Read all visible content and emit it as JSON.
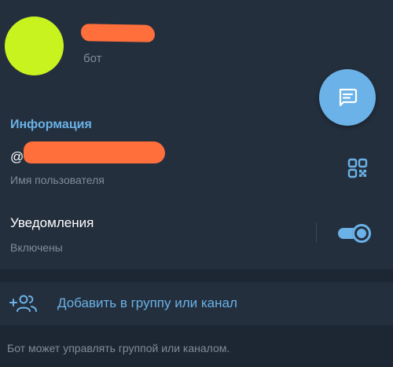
{
  "profile": {
    "subtitle": "бот"
  },
  "info": {
    "section_title": "Информация",
    "username_prefix": "@",
    "username_caption": "Имя пользователя"
  },
  "notifications": {
    "label": "Уведомления",
    "status": "Включены",
    "enabled": true
  },
  "actions": {
    "add_to_group_label": "Добавить в группу или канал",
    "hint": "Бот может управлять группой или каналом."
  },
  "icons": {
    "fab": "chat-icon",
    "qr": "qr-code-icon",
    "add": "add-user-icon"
  },
  "colors": {
    "accent": "#6ab2e7",
    "avatar": "#c8f31f",
    "redaction": "#ff6f3c",
    "background": "#1d2733",
    "surface": "#242f3d"
  }
}
